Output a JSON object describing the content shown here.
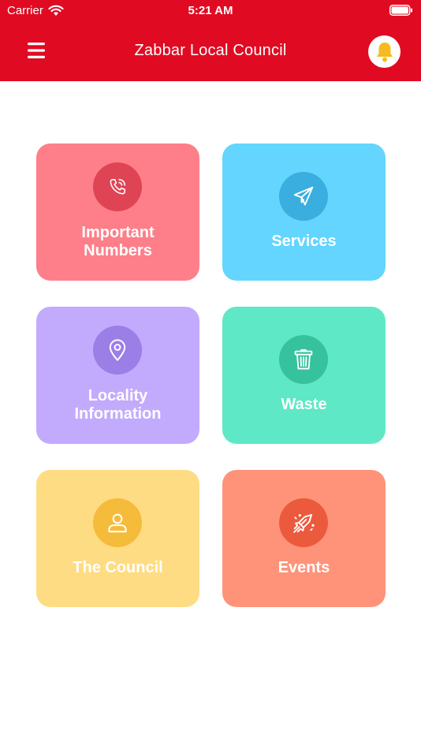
{
  "status_bar": {
    "carrier": "Carrier",
    "time": "5:21 AM"
  },
  "header": {
    "title": "Zabbar Local Council",
    "menu_icon": "hamburger-menu-icon",
    "bell_icon": "bell-icon"
  },
  "tiles": [
    {
      "id": "important-numbers",
      "line1": "Important",
      "line2": "Numbers",
      "icon": "phone-icon",
      "bg": "#fe7f89",
      "circle": "#df4454"
    },
    {
      "id": "services",
      "line1": "Services",
      "line2": "",
      "icon": "paper-plane-icon",
      "bg": "#63d5fe",
      "circle": "#3aaedf"
    },
    {
      "id": "locality-information",
      "line1": "Locality",
      "line2": "Information",
      "icon": "map-pin-icon",
      "bg": "#c2abfd",
      "circle": "#9b7ee6"
    },
    {
      "id": "waste",
      "line1": "Waste",
      "line2": "",
      "icon": "trash-bin-icon",
      "bg": "#5ee8c5",
      "circle": "#35c29d"
    },
    {
      "id": "the-council",
      "line1": "The Council",
      "line2": "",
      "icon": "person-icon",
      "bg": "#fedc83",
      "circle": "#f5bb3a"
    },
    {
      "id": "events",
      "line1": "Events",
      "line2": "",
      "icon": "firework-rocket-icon",
      "bg": "#fe937a",
      "circle": "#ec5a3e"
    }
  ],
  "colors": {
    "header": "#e00b22",
    "bell": "#f5bb1e"
  }
}
